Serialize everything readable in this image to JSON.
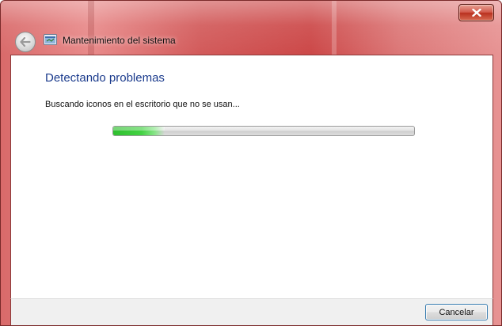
{
  "window": {
    "title": "Mantenimiento del sistema",
    "frame_color": "#d25a5a",
    "icons": {
      "back": "back-arrow-icon",
      "app": "system-maintenance-icon",
      "close": "close-icon"
    }
  },
  "main": {
    "heading": "Detectando problemas",
    "status": "Buscando iconos en el escritorio que no se usan...",
    "progress": {
      "fraction": 0.17,
      "color": "#43d243"
    }
  },
  "footer": {
    "cancel_label": "Cancelar"
  }
}
